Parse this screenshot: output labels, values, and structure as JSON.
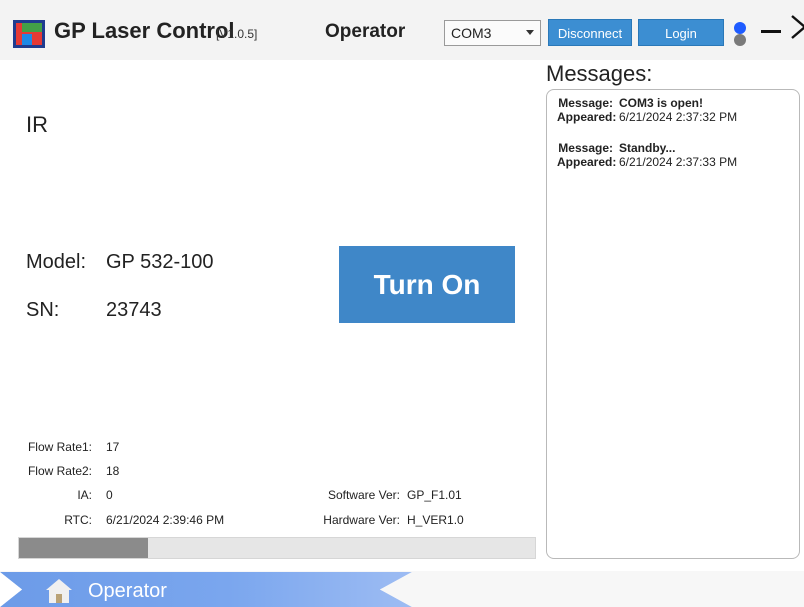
{
  "header": {
    "app_title": "GP Laser Control",
    "version": "[V1.0.5]",
    "role": "Operator",
    "port": "COM3",
    "disconnect_label": "Disconnect",
    "login_label": "Login",
    "status_colors": [
      "#1e5bff",
      "#7a7a7a"
    ]
  },
  "laser": {
    "type": "IR",
    "model_label": "Model:",
    "model": "GP 532-100",
    "sn_label": "SN:",
    "sn": "23743",
    "turn_on_label": "Turn On",
    "accent_color": "#3f87c8"
  },
  "stats": {
    "flow_rate1_label": "Flow Rate1:",
    "flow_rate1": "17",
    "flow_rate2_label": "Flow Rate2:",
    "flow_rate2": "18",
    "ia_label": "IA:",
    "ia": "0",
    "rtc_label": "RTC:",
    "rtc": "6/21/2024 2:39:46 PM",
    "software_label": "Software Ver:",
    "software": "GP_F1.01",
    "hardware_label": "Hardware Ver:",
    "hardware": "H_VER1.0"
  },
  "progress": {
    "fraction": 0.25
  },
  "messages": {
    "title": "Messages:",
    "message_key": "Message:",
    "appeared_key": "Appeared:",
    "items": [
      {
        "message": "COM3 is open!",
        "appeared": "6/21/2024 2:37:32 PM"
      },
      {
        "message": "Standby...",
        "appeared": "6/21/2024 2:37:33 PM"
      }
    ]
  },
  "nav": {
    "label": "Operator",
    "icon": "home-icon"
  }
}
